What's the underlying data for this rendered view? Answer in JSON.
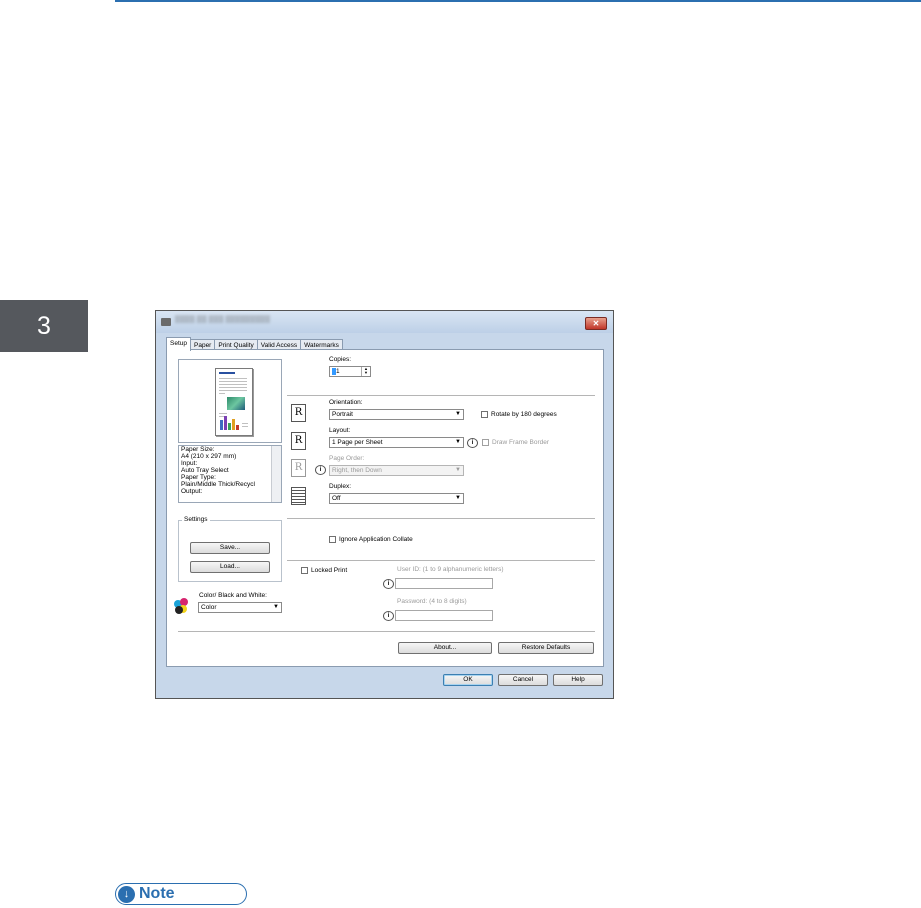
{
  "page": {
    "chapter_number": "3",
    "note_label": "Note",
    "note_icon": "down-arrow-circle-icon"
  },
  "dialog": {
    "tabs": [
      "Setup",
      "Paper",
      "Print Quality",
      "Valid Access",
      "Watermarks"
    ],
    "active_tab": "Setup",
    "close_label": "✕",
    "copies": {
      "label": "Copies:",
      "value": "1"
    },
    "orientation": {
      "label": "Orientation:",
      "value": "Portrait"
    },
    "rotate_180": {
      "label": "Rotate by 180 degrees",
      "checked": false
    },
    "layout": {
      "label": "Layout:",
      "value": "1 Page per Sheet"
    },
    "draw_frame_border": {
      "label": "Draw Frame Border",
      "checked": false
    },
    "page_order": {
      "label": "Page Order:",
      "value": "Right, then Down"
    },
    "duplex": {
      "label": "Duplex:",
      "value": "Off"
    },
    "ignore_app_collate": {
      "label": "Ignore Application Collate",
      "checked": false
    },
    "locked_print": {
      "label": "Locked Print",
      "checked": false
    },
    "user_id": {
      "label": "User ID: (1 to 9 alphanumeric letters)",
      "value": ""
    },
    "password": {
      "label": "Password: (4 to 8 digits)",
      "value": ""
    },
    "summary_lines": [
      "Paper Size:",
      " A4 (210 x 297 mm)",
      "Input:",
      " Auto Tray Select",
      "Paper Type:",
      " Plain/Middle Thick/Recycl",
      "Output:"
    ],
    "settings": {
      "legend": "Settings",
      "save_label": "Save...",
      "load_label": "Load..."
    },
    "color_mode": {
      "label": "Color/ Black and White:",
      "value": "Color"
    },
    "about_label": "About...",
    "restore_label": "Restore Defaults",
    "ok_label": "OK",
    "cancel_label": "Cancel",
    "help_label": "Help",
    "icon_glyph": "R",
    "info_glyph": "i",
    "dropdown_arrow": "▼",
    "spin_up": "▲",
    "spin_down": "▼"
  },
  "colors": {
    "accent_blue": "#2b6fb0",
    "chapter_tab": "#55585d",
    "dialog_frame": "#c7d7ea",
    "close_red": "#c1362a"
  }
}
